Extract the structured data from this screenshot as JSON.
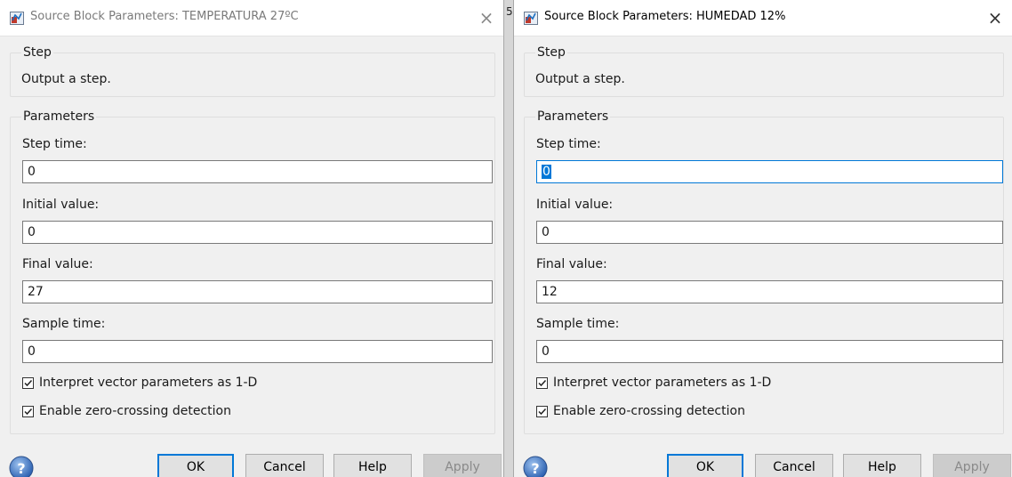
{
  "gap_label": "5",
  "dialogs": [
    {
      "title": "Source Block Parameters: TEMPERATURA 27ºC",
      "close": "×",
      "step_legend": "Step",
      "step_desc": "Output a step.",
      "params_legend": "Parameters",
      "step_time_label": "Step time:",
      "step_time_value": "0",
      "initial_value_label": "Initial value:",
      "initial_value_value": "0",
      "final_value_label": "Final value:",
      "final_value_value": "27",
      "sample_time_label": "Sample time:",
      "sample_time_value": "0",
      "interpret_vector_label": "Interpret vector parameters as 1-D",
      "interpret_vector_checked": true,
      "zero_crossing_label": "Enable zero-crossing detection",
      "zero_crossing_checked": true,
      "ok": "OK",
      "cancel": "Cancel",
      "help": "Help",
      "apply": "Apply"
    },
    {
      "title": "Source Block Parameters: HUMEDAD 12%",
      "close": "×",
      "step_legend": "Step",
      "step_desc": "Output a step.",
      "params_legend": "Parameters",
      "step_time_label": "Step time:",
      "step_time_value": "0",
      "initial_value_label": "Initial value:",
      "initial_value_value": "0",
      "final_value_label": "Final value:",
      "final_value_value": "12",
      "sample_time_label": "Sample time:",
      "sample_time_value": "0",
      "interpret_vector_label": "Interpret vector parameters as 1-D",
      "interpret_vector_checked": true,
      "zero_crossing_label": "Enable zero-crossing detection",
      "zero_crossing_checked": true,
      "ok": "OK",
      "cancel": "Cancel",
      "help": "Help",
      "apply": "Apply"
    }
  ],
  "colors": {
    "accent": "#0078d7",
    "dialog_bg": "#f0f0f0",
    "titlebar_bg": "#ffffff"
  }
}
